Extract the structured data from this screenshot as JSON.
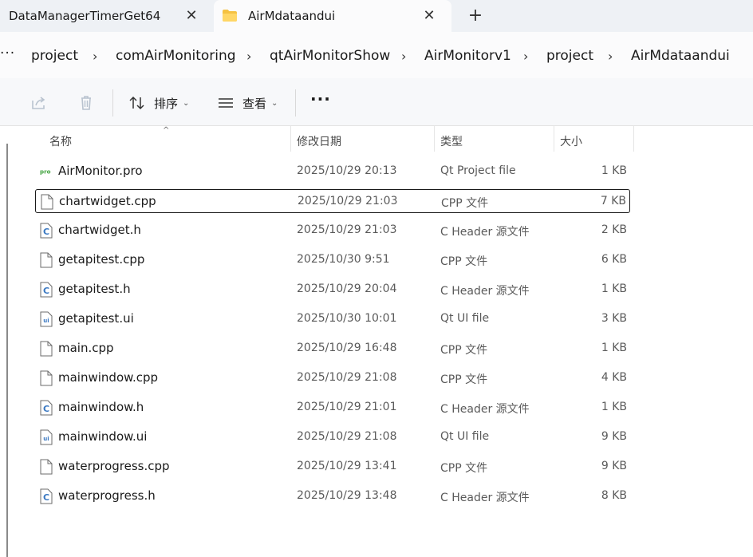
{
  "tabs": [
    {
      "label": "DataManagerTimerGet64",
      "active": false
    },
    {
      "label": "AirMdataandui",
      "active": true
    }
  ],
  "breadcrumb": [
    "project",
    "comAirMonitoring",
    "qtAirMonitorShow",
    "AirMonitorv1",
    "project",
    "AirMdataandui"
  ],
  "breadcrumb_overflow": "···",
  "breadcrumb_separator": "›",
  "toolbar": {
    "sort_label": "排序",
    "view_label": "查看",
    "more_label": "···"
  },
  "columns": {
    "name": "名称",
    "modified": "修改日期",
    "type": "类型",
    "size": "大小"
  },
  "files": [
    {
      "name": "AirMonitor.pro",
      "modified": "2025/10/29 20:13",
      "type": "Qt Project file",
      "size": "1 KB",
      "icon": "pro"
    },
    {
      "name": "chartwidget.cpp",
      "modified": "2025/10/29 21:03",
      "type": "CPP 文件",
      "size": "7 KB",
      "icon": "file"
    },
    {
      "name": "chartwidget.h",
      "modified": "2025/10/29 21:03",
      "type": "C Header 源文件",
      "size": "2 KB",
      "icon": "c"
    },
    {
      "name": "getapitest.cpp",
      "modified": "2025/10/30 9:51",
      "type": "CPP 文件",
      "size": "6 KB",
      "icon": "file"
    },
    {
      "name": "getapitest.h",
      "modified": "2025/10/29 20:04",
      "type": "C Header 源文件",
      "size": "1 KB",
      "icon": "c"
    },
    {
      "name": "getapitest.ui",
      "modified": "2025/10/30 10:01",
      "type": "Qt UI file",
      "size": "3 KB",
      "icon": "ui"
    },
    {
      "name": "main.cpp",
      "modified": "2025/10/29 16:48",
      "type": "CPP 文件",
      "size": "1 KB",
      "icon": "file"
    },
    {
      "name": "mainwindow.cpp",
      "modified": "2025/10/29 21:08",
      "type": "CPP 文件",
      "size": "4 KB",
      "icon": "file"
    },
    {
      "name": "mainwindow.h",
      "modified": "2025/10/29 21:01",
      "type": "C Header 源文件",
      "size": "1 KB",
      "icon": "c"
    },
    {
      "name": "mainwindow.ui",
      "modified": "2025/10/29 21:08",
      "type": "Qt UI file",
      "size": "9 KB",
      "icon": "ui"
    },
    {
      "name": "waterprogress.cpp",
      "modified": "2025/10/29 13:41",
      "type": "CPP 文件",
      "size": "9 KB",
      "icon": "file"
    },
    {
      "name": "waterprogress.h",
      "modified": "2025/10/29 13:48",
      "type": "C Header 源文件",
      "size": "8 KB",
      "icon": "c"
    }
  ],
  "colors": {
    "folder": "#f5c242",
    "c_icon": "#3a78c2",
    "pro_icon": "#41a33f",
    "ui_icon": "#3a78c2"
  }
}
